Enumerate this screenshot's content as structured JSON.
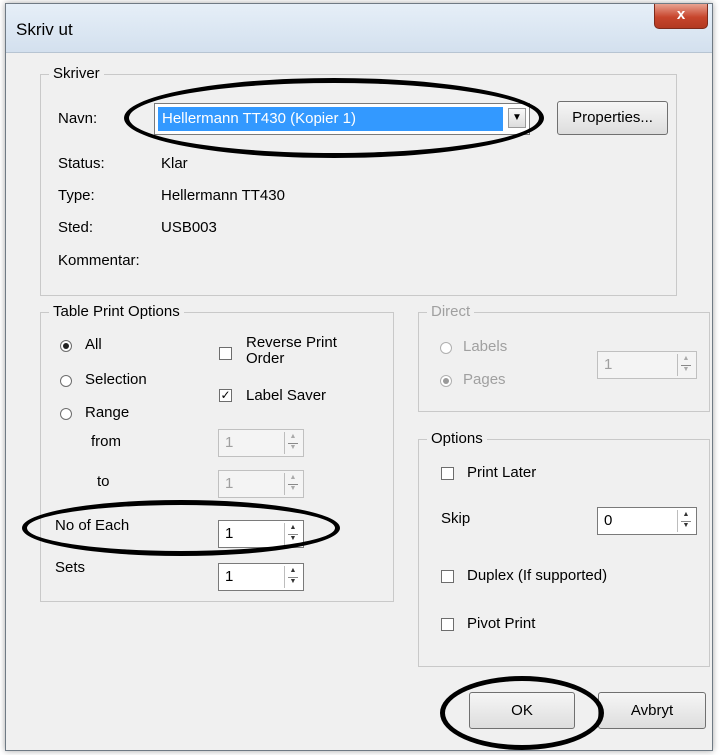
{
  "window": {
    "title": "Skriv ut",
    "close_glyph": "x"
  },
  "printer": {
    "group_title": "Skriver",
    "name_label": "Navn:",
    "name_value": "Hellermann TT430 (Kopier 1)",
    "properties_button": "Properties...",
    "status_label": "Status:",
    "status_value": "Klar",
    "type_label": "Type:",
    "type_value": "Hellermann TT430",
    "location_label": "Sted:",
    "location_value": "USB003",
    "comment_label": "Kommentar:"
  },
  "table_print_options": {
    "group_title": "Table Print Options",
    "radio_all": "All",
    "radio_selection": "Selection",
    "radio_range": "Range",
    "from_label": "from",
    "from_value": "1",
    "to_label": "to",
    "to_value": "1",
    "reverse_print_order": "Reverse Print Order",
    "label_saver": "Label Saver",
    "no_of_each_label": "No of Each",
    "no_of_each_value": "1",
    "sets_label": "Sets",
    "sets_value": "1",
    "selected_radio": "All",
    "label_saver_checked": true,
    "reverse_print_order_checked": false
  },
  "direct": {
    "group_title": "Direct",
    "radio_labels": "Labels",
    "radio_pages": "Pages",
    "value": "1",
    "selected_radio": "Pages"
  },
  "options": {
    "group_title": "Options",
    "print_later": "Print Later",
    "skip_label": "Skip",
    "skip_value": "0",
    "duplex": "Duplex (If supported)",
    "pivot_print": "Pivot Print"
  },
  "buttons": {
    "ok": "OK",
    "cancel": "Avbryt"
  },
  "icons": {
    "dropdown": "chevron-down-icon",
    "check": "checkmark-icon",
    "spin_up": "▲",
    "spin_down": "▼"
  },
  "colors": {
    "selection": "#3399ff",
    "close_button": "#c7452c",
    "annotation": "#000000"
  }
}
